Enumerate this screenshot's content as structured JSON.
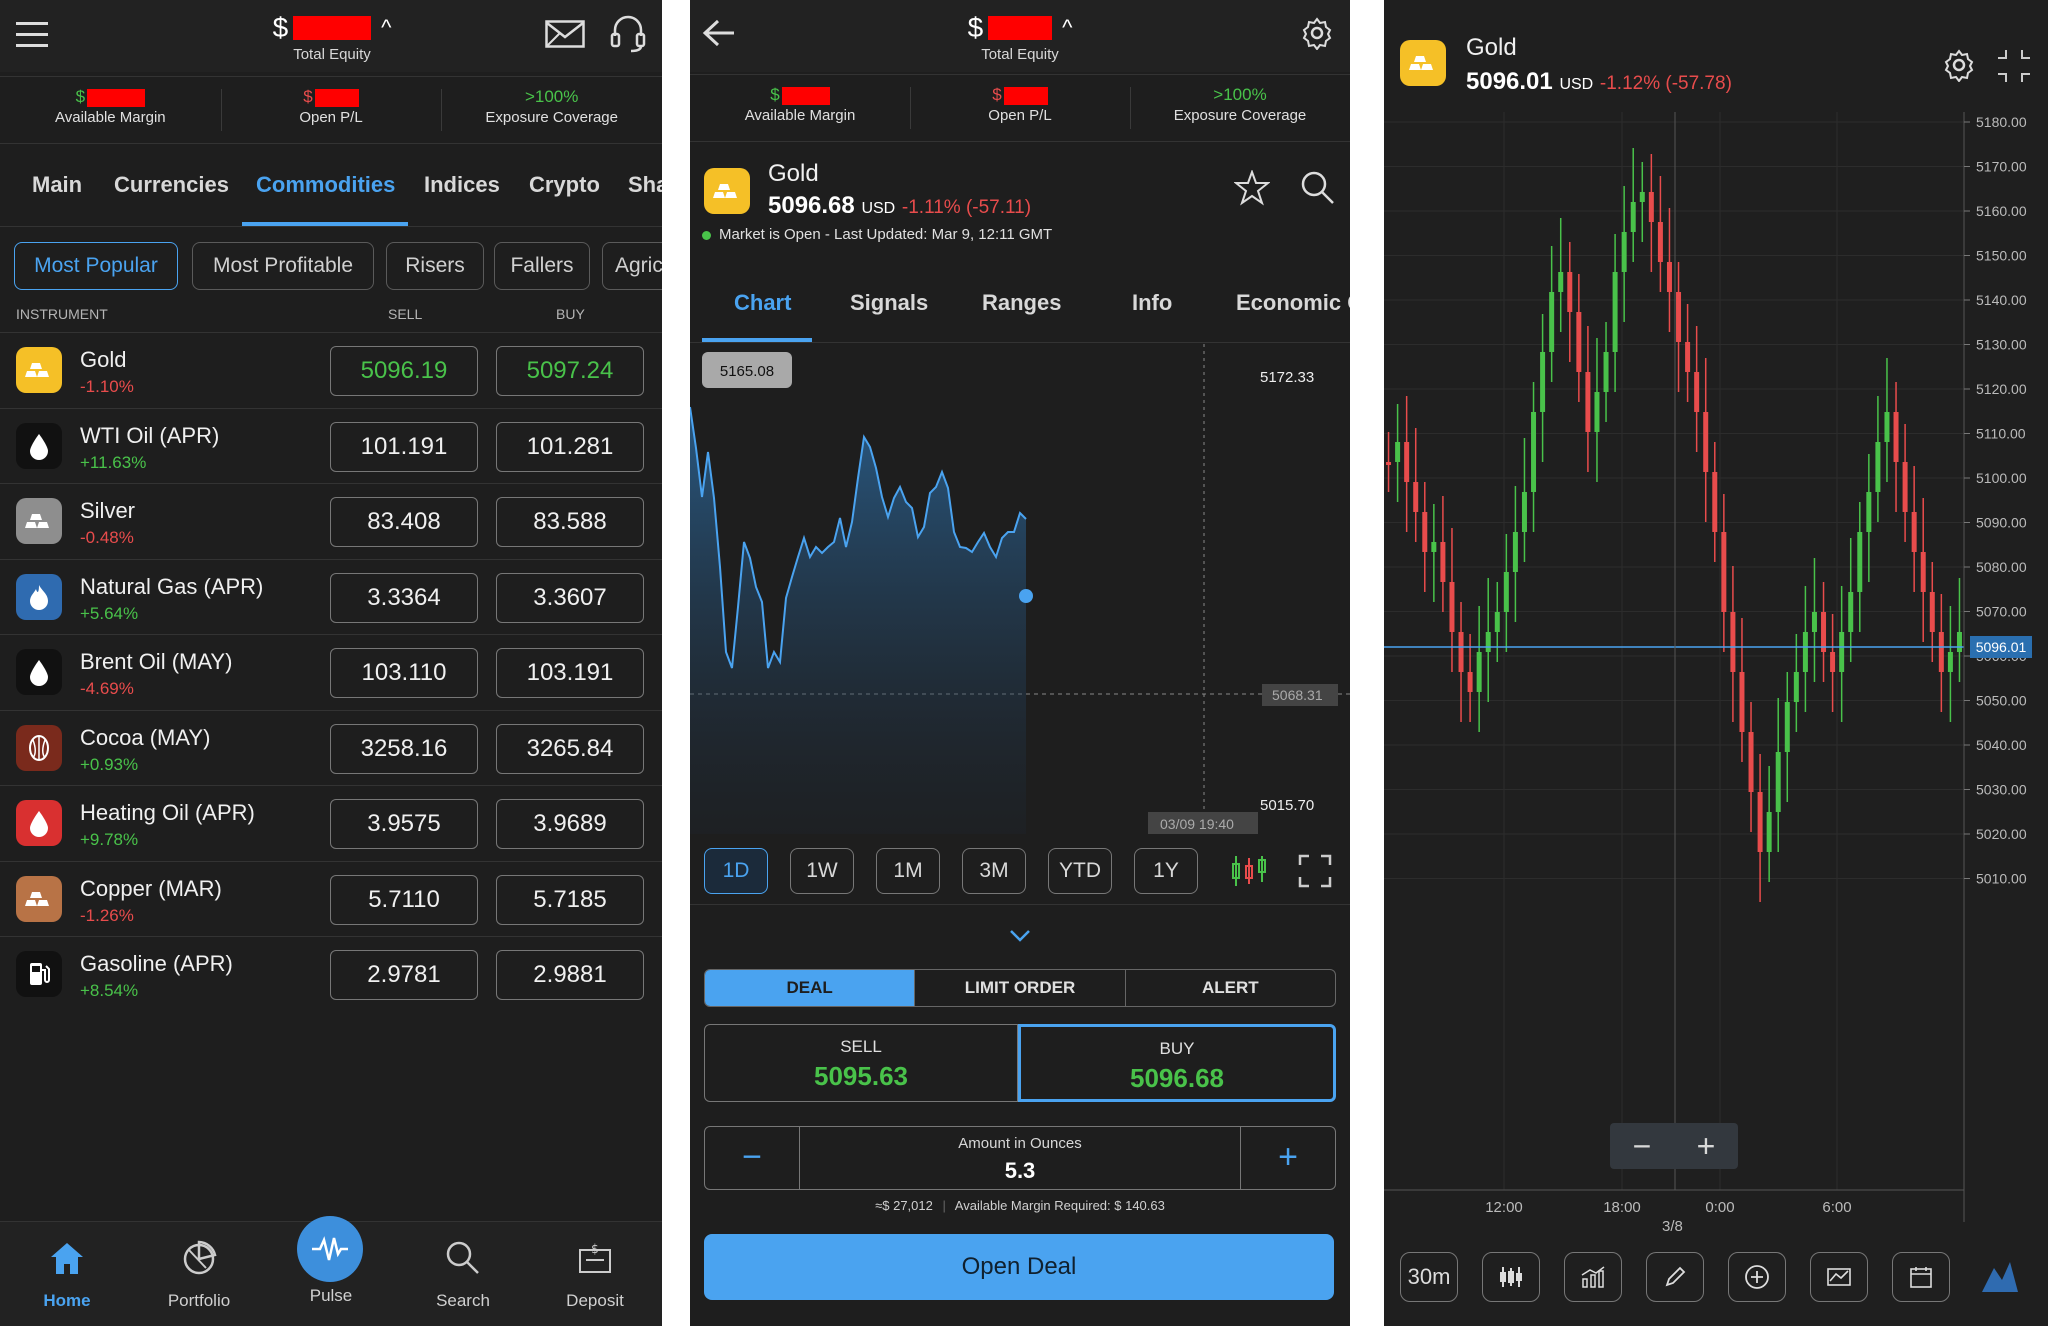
{
  "header": {
    "currency": "$",
    "total_equity_label": "Total Equity",
    "stats": [
      {
        "prefix": "$",
        "label": "Available Margin"
      },
      {
        "prefix": "$",
        "label": "Open P/L"
      },
      {
        "value": ">100%",
        "label": "Exposure Coverage"
      }
    ]
  },
  "panel1": {
    "tabs": [
      "Main",
      "Currencies",
      "Commodities",
      "Indices",
      "Crypto",
      "Sha"
    ],
    "active_tab": "Commodities",
    "filters": [
      "Most Popular",
      "Most Profitable",
      "Risers",
      "Fallers",
      "Agric"
    ],
    "active_filter": "Most Popular",
    "columns": {
      "instrument": "INSTRUMENT",
      "sell": "SELL",
      "buy": "BUY"
    },
    "instruments": [
      {
        "name": "Gold",
        "change": "-1.10%",
        "sell": "5096.19",
        "buy": "5097.24",
        "icon": "gold-bar-icon",
        "color": "#f5c027"
      },
      {
        "name": "WTI Oil (APR)",
        "change": "+11.63%",
        "sell": "101.191",
        "buy": "101.281",
        "icon": "oil-drop-icon",
        "color": "#111111"
      },
      {
        "name": "Silver",
        "change": "-0.48%",
        "sell": "83.408",
        "buy": "83.588",
        "icon": "silver-bar-icon",
        "color": "#8e8e8e"
      },
      {
        "name": "Natural Gas (APR)",
        "change": "+5.64%",
        "sell": "3.3364",
        "buy": "3.3607",
        "icon": "flame-icon",
        "color": "#2f6bb0"
      },
      {
        "name": "Brent Oil (MAY)",
        "change": "-4.69%",
        "sell": "103.110",
        "buy": "103.191",
        "icon": "oil-drop-icon",
        "color": "#111111"
      },
      {
        "name": "Cocoa (MAY)",
        "change": "+0.93%",
        "sell": "3258.16",
        "buy": "3265.84",
        "icon": "cocoa-icon",
        "color": "#7a2a1c"
      },
      {
        "name": "Heating Oil (APR)",
        "change": "+9.78%",
        "sell": "3.9575",
        "buy": "3.9689",
        "icon": "oil-drop-icon",
        "color": "#d93030"
      },
      {
        "name": "Copper (MAR)",
        "change": "-1.26%",
        "sell": "5.7110",
        "buy": "5.7185",
        "icon": "copper-bar-icon",
        "color": "#b87346"
      },
      {
        "name": "Gasoline (APR)",
        "change": "+8.54%",
        "sell": "2.9781",
        "buy": "2.9881",
        "icon": "fuel-pump-icon",
        "color": "#111111"
      }
    ],
    "nav": [
      "Home",
      "Portfolio",
      "Pulse",
      "Search",
      "Deposit"
    ],
    "active_nav": "Home"
  },
  "panel2": {
    "name": "Gold",
    "price": "5096.68",
    "currency": "USD",
    "change": "-1.11% (-57.11)",
    "status": "Market is Open - Last Updated: Mar 9, 12:11 GMT",
    "tabs": [
      "Chart",
      "Signals",
      "Ranges",
      "Info",
      "Economic C"
    ],
    "active_tab": "Chart",
    "chart": {
      "tooltip": "5165.08",
      "high_label": "5172.33",
      "low_label": "5015.70",
      "ref_label": "5068.31",
      "time_label": "03/09 19:40"
    },
    "ranges": [
      "1D",
      "1W",
      "1M",
      "3M",
      "YTD",
      "1Y"
    ],
    "active_range": "1D",
    "order_tabs": [
      "DEAL",
      "LIMIT ORDER",
      "ALERT"
    ],
    "active_order_tab": "DEAL",
    "sell_label": "SELL",
    "sell_price": "5095.63",
    "buy_label": "BUY",
    "buy_price": "5096.68",
    "amount_label": "Amount in Ounces",
    "amount": "5.3",
    "value_text": "≈$ 27,012",
    "margin_text": "Available Margin Required: $ 140.63",
    "open_deal": "Open Deal"
  },
  "panel3": {
    "name": "Gold",
    "price": "5096.01",
    "currency": "USD",
    "change": "-1.12% (-57.78)",
    "price_tag": "5096.01",
    "y_ticks": [
      "5180.00",
      "5170.00",
      "5160.00",
      "5150.00",
      "5140.00",
      "5130.00",
      "5120.00",
      "5110.00",
      "5100.00",
      "5090.00",
      "5080.00",
      "5070.00",
      "5060.00",
      "5050.00",
      "5040.00",
      "5030.00",
      "5020.00",
      "5010.00"
    ],
    "x_ticks": [
      "12:00",
      "18:00",
      "0:00",
      "6:00"
    ],
    "date_label": "3/8",
    "interval": "30m"
  },
  "colors": {
    "accent": "#4aa3f0",
    "up": "#49c24a",
    "down": "#e84c4c",
    "gold": "#f5c027"
  }
}
